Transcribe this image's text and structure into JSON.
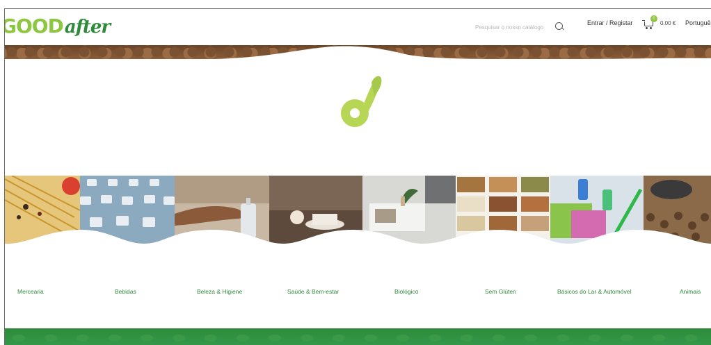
{
  "header": {
    "logo_good": "GOOD",
    "logo_after": "after",
    "search_placeholder": "Pesquisar o nosso catálogo",
    "login_label": "Entrar / Registar",
    "cart_count": "0",
    "cart_total": "0.00 €",
    "language": "Português"
  },
  "categories": [
    {
      "label": "Mercearia"
    },
    {
      "label": "Bebidas"
    },
    {
      "label": "Beleza & Higiene"
    },
    {
      "label": "Saúde & Bem-estar"
    },
    {
      "label": "Biológico"
    },
    {
      "label": "Sem Glúten"
    },
    {
      "label": "Básicos do Lar & Automóvel"
    },
    {
      "label": "Animais"
    }
  ],
  "colors": {
    "brand_green": "#8dc63f",
    "dark_green": "#2e8b3a",
    "footer_green": "#2c8c3a"
  },
  "icons": {
    "search": "search-icon",
    "cart": "cart-icon"
  }
}
